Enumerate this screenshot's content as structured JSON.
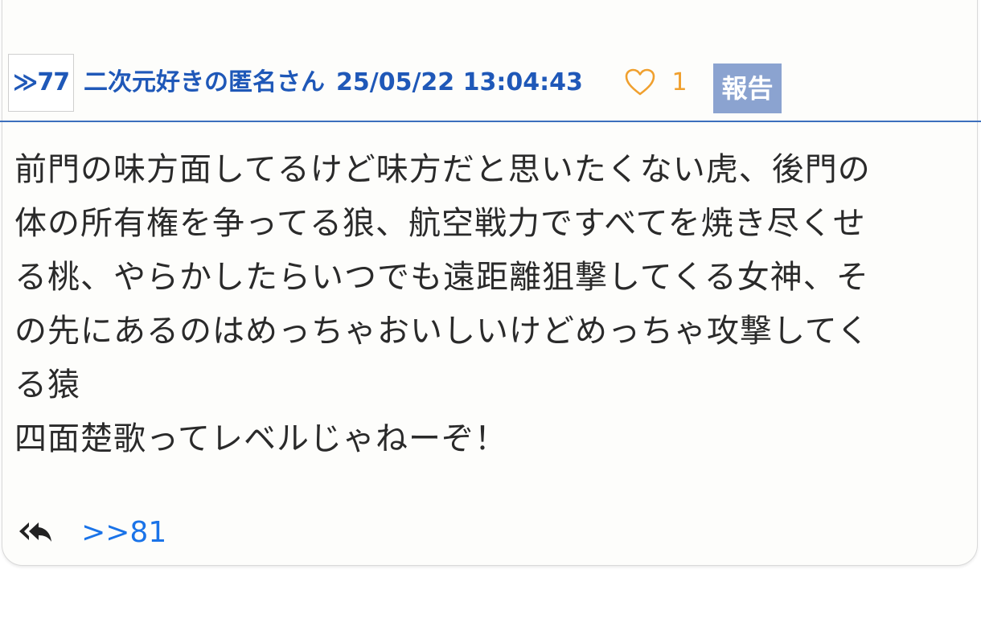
{
  "post": {
    "number": "≫77",
    "poster": "二次元好きの匿名さん",
    "timestamp": "25/05/22 13:04:43",
    "like_count": "1",
    "report_label": "報告",
    "body_lines": [
      "前門の味方面してるけど味方だと思いたくない虎、後門の",
      "体の所有権を争ってる狼、航空戦力ですべてを焼き尽くせ",
      "る桃、やらかしたらいつでも遠距離狙撃してくる女神、そ",
      "の先にあるのはめっちゃおいしいけどめっちゃ攻撃してく",
      "る猿",
      "四面楚歌ってレベルじゃねーぞ！"
    ],
    "reply_link": ">>81"
  },
  "icons": {
    "like": "heart-outline-icon",
    "reply": "reply-all-icon"
  },
  "colors": {
    "accent": "#1f58b8",
    "like": "#f0a02e",
    "report_bg": "#8ba3d0",
    "link": "#1a73e8",
    "divider": "#3c6fbd"
  }
}
